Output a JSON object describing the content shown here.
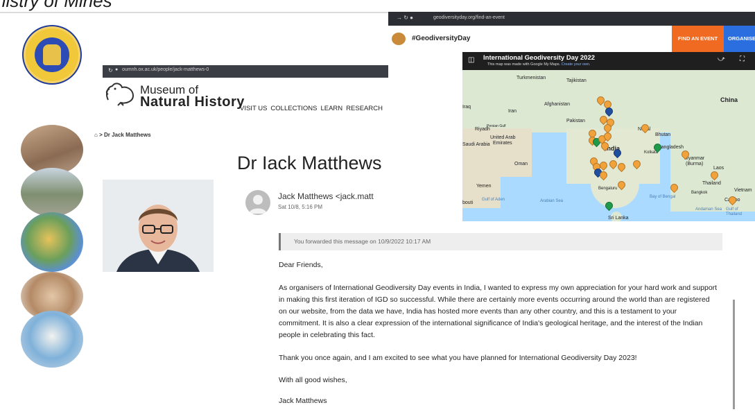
{
  "slide": {
    "title": "nistry of Mines"
  },
  "mnh": {
    "url": "oumnh.ox.ac.uk/people/jack-matthews-0",
    "brand_line1": "Museum of",
    "brand_line2": "Natural History",
    "nav": [
      "VISIT US",
      "COLLECTIONS",
      "LEARN",
      "RESEARCH"
    ],
    "breadcrumb": "> Dr Jack Matthews",
    "heading": "Dr Iack Matthews",
    "mail_from": "Jack Matthews <jack.matt",
    "mail_date": "Sat 10/8, 5:16 PM"
  },
  "geo": {
    "url": "geodiversityday.org/find-an-event",
    "site_name": "#GeodiversityDay",
    "btn_find": "FIND AN EVENT",
    "btn_organise": "ORGANISE",
    "map_title": "International Geodiversity Day 2022",
    "map_sub_prefix": "This map was made with Google My Maps.",
    "map_sub_link": "Create your own.",
    "places": {
      "turkmenistan": "Turkmenistan",
      "tajikistan": "Tajikistan",
      "iraq": "Iraq",
      "iran": "Iran",
      "afghanistan": "Afghanistan",
      "pakistan": "Pakistan",
      "china": "China",
      "nepal": "Nepal",
      "bhutan": "Bhutan",
      "riyadh": "Riyadh",
      "uae_1": "United Arab",
      "uae_2": "Emirates",
      "saudi": "Saudi Arabia",
      "india": "India",
      "kolkata": "Kolkata",
      "bangladesh": "Bangladesh",
      "oman": "Oman",
      "myanmar_1": "Myanmar",
      "myanmar_2": "(Burma)",
      "laos": "Laos",
      "yemen": "Yemen",
      "thailand": "Thailand",
      "vietnam": "Vietnam",
      "bengaluru": "Bengaluru",
      "bangkok": "Bangkok",
      "cambodia": "Cambo",
      "gulf_aden": "Gulf of Aden",
      "arabian_sea": "Arabian Sea",
      "bay_bengal": "Bay of Bengal",
      "andaman": "Andaman Sea",
      "gulf_thailand_1": "Gulf of",
      "gulf_thailand_2": "Thailand",
      "sri_lanka": "Sri Lanka",
      "bouti": "bouti",
      "persian_gulf": "Persian Gulf"
    }
  },
  "email": {
    "forwarded": "You forwarded this message on 10/9/2022 10:17 AM",
    "greeting": "Dear Friends,",
    "body": "As organisers of International Geodiversity Day events in India, I wanted to express my own appreciation for your hard work and support in making this first iteration of IGD so successful. While there are certainly more events occurring around the world than are registered on our website, from the data we have, India has hosted more events than any other country, and this is a testament to your commitment. It is also a clear expression of the international significance of India's geological heritage, and the interest of the Indian people in celebrating this fact.",
    "thanks": "Thank you once again, and I am excited to see what you have planned for International Geodiversity Day 2023!",
    "closing": "With all good wishes,",
    "signature": "Jack Matthews"
  },
  "colors": {
    "orange_button": "#f06a22",
    "blue_button": "#2a6ee0",
    "pin_orange": "#f2a23a",
    "pin_blue": "#1f4f9e",
    "pin_green": "#1f9a4a"
  }
}
